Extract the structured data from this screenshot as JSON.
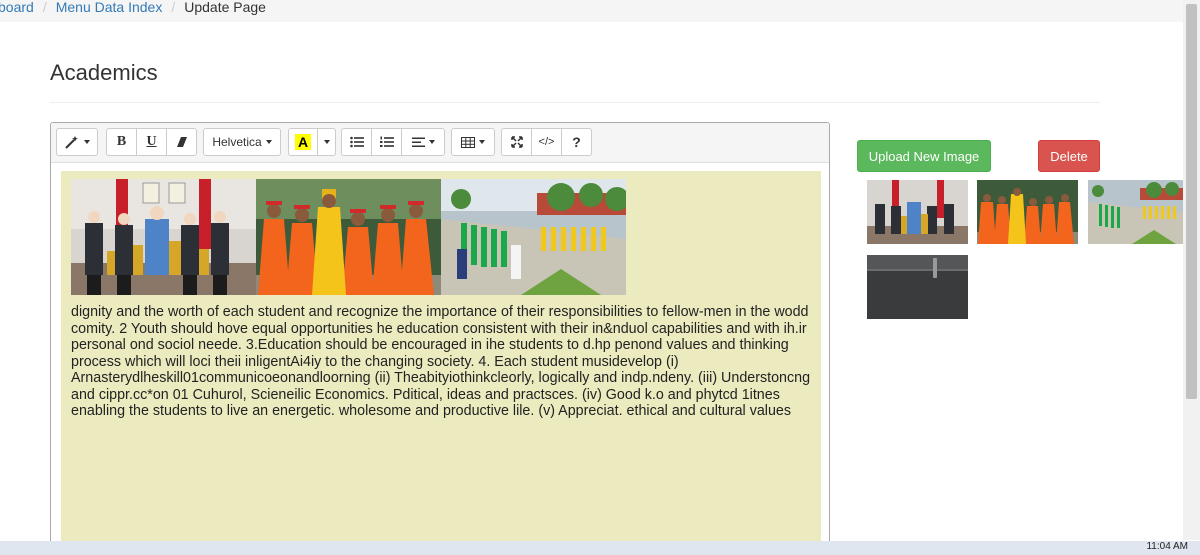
{
  "breadcrumb": {
    "items": [
      {
        "label": "board",
        "link": true
      },
      {
        "label": "Menu Data Index",
        "link": true
      },
      {
        "label": "Update Page",
        "link": false
      }
    ],
    "separator": "/"
  },
  "page": {
    "title": "Academics"
  },
  "toolbar": {
    "font_name": "Helvetica",
    "color_label": "A",
    "help_label": "?",
    "bold_label": "B",
    "underline_label": "U",
    "code_label": "</>",
    "icons": [
      "magic-icon",
      "eraser-icon",
      "unordered-list-icon",
      "ordered-list-icon",
      "align-left-icon",
      "table-icon",
      "fullscreen-icon",
      "code-view-icon"
    ]
  },
  "editor": {
    "images": [
      {
        "name": "students-trophies-photo"
      },
      {
        "name": "cultural-dance-photo"
      },
      {
        "name": "school-assembly-photo"
      }
    ],
    "text": "dignity and the worth of each student and recognize the importance of their responsibilities to fellow-men in the wodd comity. 2 Youth should hove equal opportunities he education consistent with their in&nduol capabilities and with ih.ir personal ond sociol neede. 3.Education should be encouraged in ihe students to d.hp penond values and thinking process which will loci theii inligentAi4iy to the changing society. 4. Each student musidevelop (i) Arnasterydlheskill01communicoeonandloorning (ii) Theabityiothinkcleorly, logically and indp.ndeny. (iii) Understoncng and cippr.cc*on 01 Cuhurol, Scieneilic Economics. Pditical, ideas and practsces. (iv) Good k.o and phytcd 1itnes enabling the students to live an energetic. wholesome and productive lile. (v) Appreciat. ethical and cultural values"
  },
  "actions": {
    "upload_label": "Upload New Image",
    "delete_label": "Delete"
  },
  "gallery": [
    {
      "name": "students-trophies-thumb"
    },
    {
      "name": "cultural-dance-thumb"
    },
    {
      "name": "school-assembly-thumb"
    },
    {
      "name": "pen-thumb"
    }
  ],
  "taskbar": {
    "time": "11:04 AM"
  },
  "colors": {
    "editor_bg": "#ecebc0",
    "upload_btn": "#5cb85c",
    "delete_btn": "#d9534f",
    "link": "#337ab7"
  }
}
